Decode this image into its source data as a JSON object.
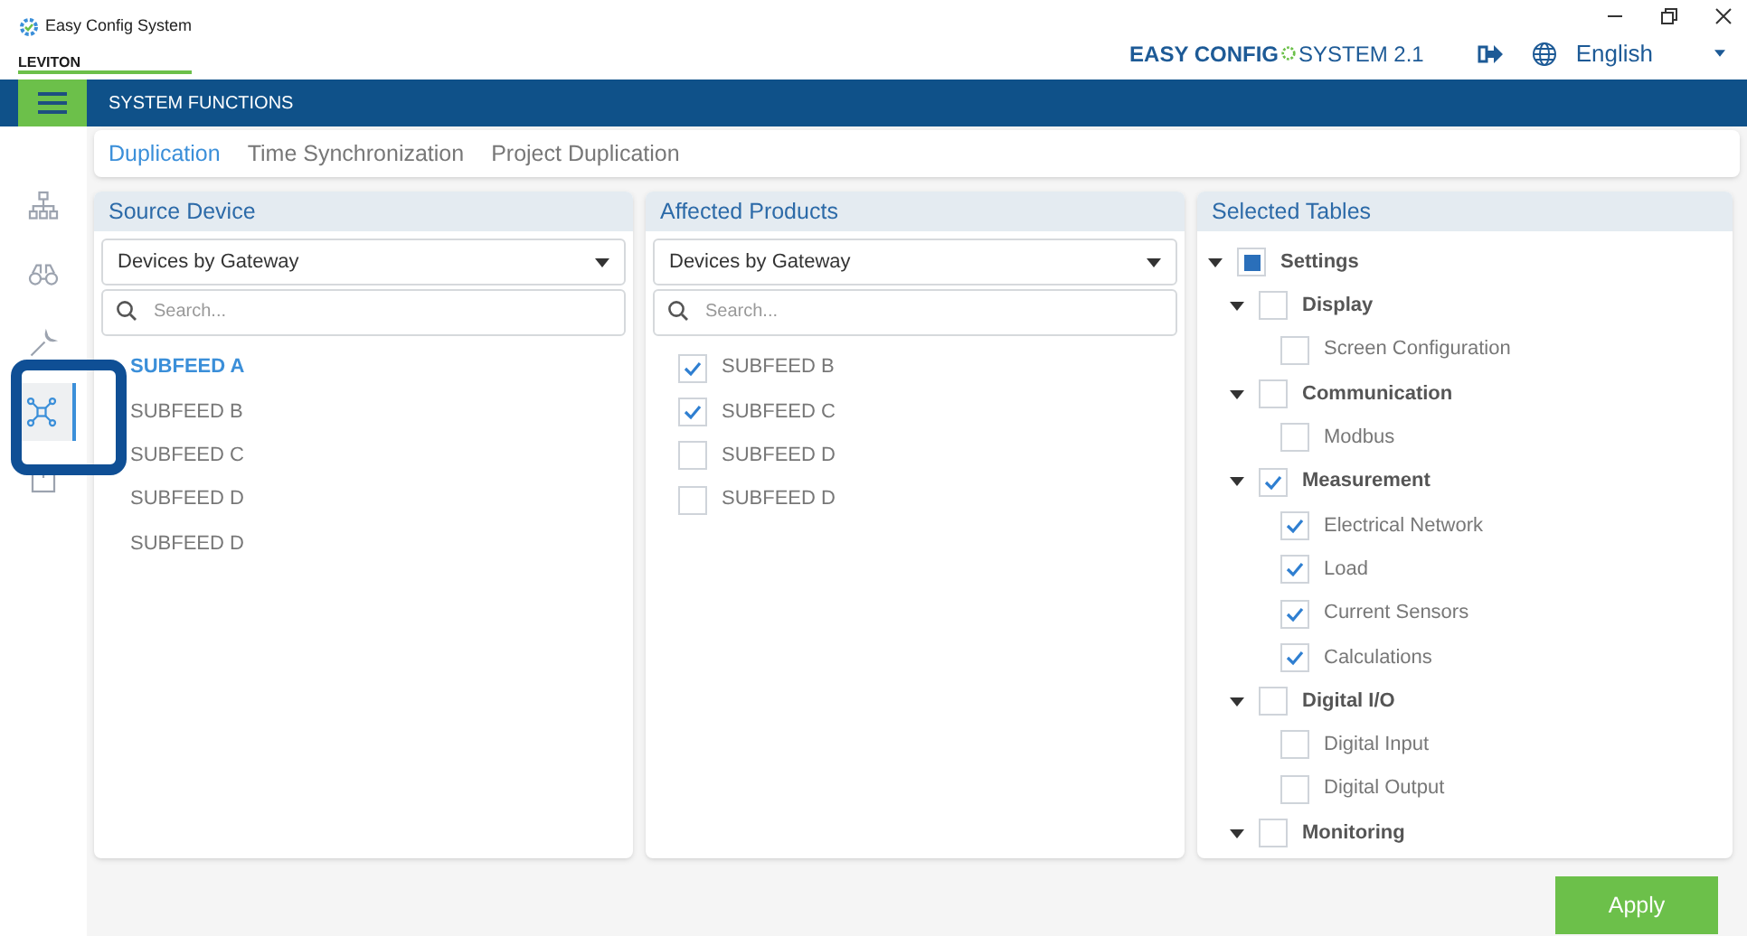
{
  "window": {
    "title": "Easy Config System",
    "brand": "LEVITON",
    "product_left": "EASY CONFIG",
    "product_right": "SYSTEM 2.1",
    "language": "English"
  },
  "header": {
    "title": "SYSTEM FUNCTIONS"
  },
  "sidebar": {
    "items": [
      {
        "kind": "network",
        "selected": false
      },
      {
        "kind": "binoculars",
        "selected": false
      },
      {
        "kind": "wrench",
        "selected": false
      },
      {
        "kind": "nodes",
        "selected": true
      },
      {
        "kind": "box",
        "selected": false
      }
    ]
  },
  "tabs": [
    {
      "label": "Duplication",
      "selected": true
    },
    {
      "label": "Time Synchronization",
      "selected": false
    },
    {
      "label": "Project Duplication",
      "selected": false
    }
  ],
  "source": {
    "title": "Source Device",
    "dropdown": "Devices by Gateway",
    "search_placeholder": "Search...",
    "items": [
      {
        "label": "SUBFEED A",
        "selected": true
      },
      {
        "label": "SUBFEED B",
        "selected": false
      },
      {
        "label": "SUBFEED C",
        "selected": false
      },
      {
        "label": "SUBFEED D",
        "selected": false
      },
      {
        "label": "SUBFEED D",
        "selected": false
      }
    ]
  },
  "affected": {
    "title": "Affected Products",
    "dropdown": "Devices by Gateway",
    "search_placeholder": "Search...",
    "items": [
      {
        "label": "SUBFEED B",
        "checked": true
      },
      {
        "label": "SUBFEED C",
        "checked": true
      },
      {
        "label": "SUBFEED D",
        "checked": false
      },
      {
        "label": "SUBFEED D",
        "checked": false
      }
    ]
  },
  "tables": {
    "title": "Selected Tables",
    "tree": [
      {
        "label": "Settings",
        "checked": false,
        "partial": true,
        "expanded": true,
        "children": [
          {
            "label": "Display",
            "checked": false,
            "partial": false,
            "expanded": true,
            "children": [
              {
                "label": "Screen Configuration",
                "checked": false,
                "partial": false
              }
            ]
          },
          {
            "label": "Communication",
            "checked": false,
            "partial": false,
            "expanded": true,
            "children": [
              {
                "label": "Modbus",
                "checked": false,
                "partial": false
              }
            ]
          },
          {
            "label": "Measurement",
            "checked": true,
            "partial": false,
            "expanded": true,
            "children": [
              {
                "label": "Electrical Network",
                "checked": true,
                "partial": false
              },
              {
                "label": "Load",
                "checked": true,
                "partial": false
              },
              {
                "label": "Current Sensors",
                "checked": true,
                "partial": false
              },
              {
                "label": "Calculations",
                "checked": true,
                "partial": false
              }
            ]
          },
          {
            "label": "Digital I/O",
            "checked": false,
            "partial": false,
            "expanded": true,
            "children": [
              {
                "label": "Digital Input",
                "checked": false,
                "partial": false
              },
              {
                "label": "Digital Output",
                "checked": false,
                "partial": false
              }
            ]
          },
          {
            "label": "Monitoring",
            "checked": false,
            "partial": false,
            "expanded": true
          }
        ]
      }
    ]
  },
  "apply_button": "Apply"
}
